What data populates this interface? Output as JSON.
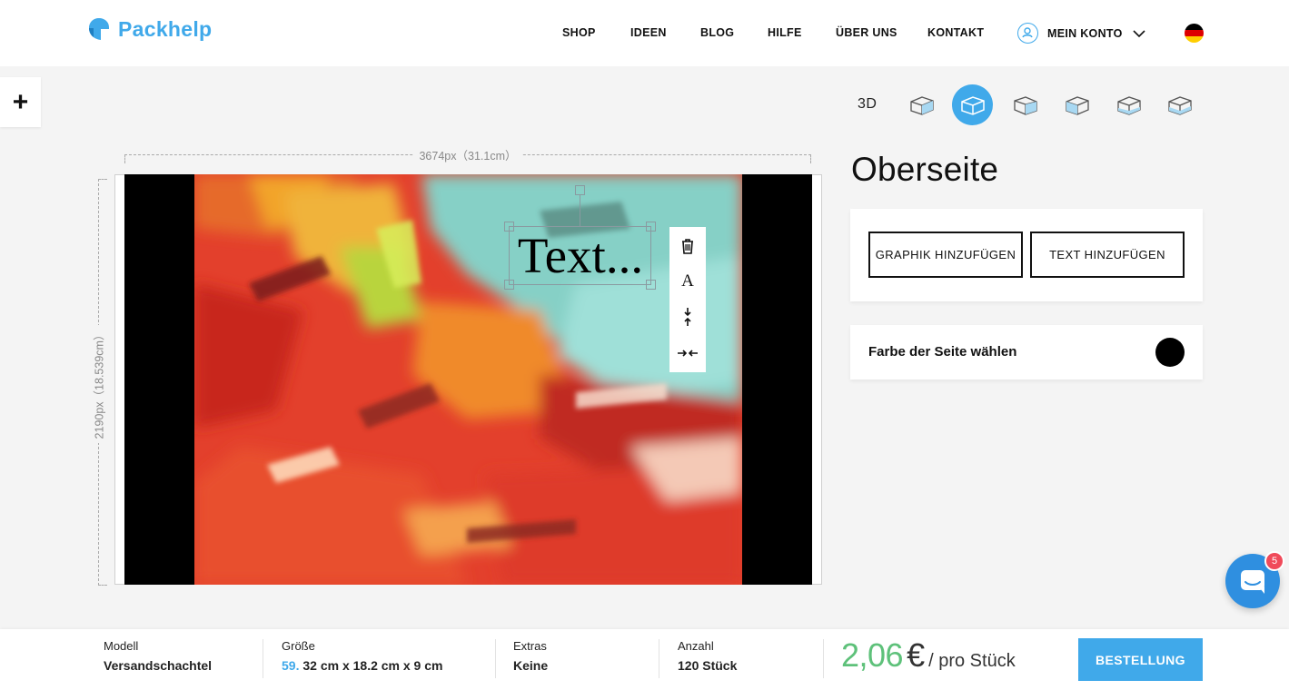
{
  "header": {
    "logo_text": "Packhelp",
    "nav": [
      "SHOP",
      "IDEEN",
      "BLOG",
      "HILFE",
      "ÜBER UNS",
      "KONTAKT"
    ],
    "account_label": "MEIN KONTO",
    "language_flag": "de-flag-icon"
  },
  "left_tools": {
    "add_icon": "+"
  },
  "views": {
    "three_d_label": "3D",
    "icons": [
      "box-view-1-icon",
      "box-view-top-icon",
      "box-view-3-icon",
      "box-view-4-icon",
      "box-view-5-icon",
      "box-view-6-icon"
    ],
    "active_index": 1
  },
  "editor": {
    "width_label": "3674px（31.1cm）",
    "height_label": "2190px（18.539cm）",
    "text_element": "Text...",
    "tools": {
      "delete_icon": "trash-icon",
      "font_glyph": "A",
      "line_height_icon": "line-height-icon",
      "letter_spacing_icon": "letter-spacing-icon"
    }
  },
  "side_panel": {
    "title": "Oberseite",
    "add_graphic": "GRAPHIK HINZUFÜGEN",
    "add_text": "TEXT HINZUFÜGEN",
    "color_label": "Farbe der Seite wählen",
    "side_color": "#000000"
  },
  "chat": {
    "badge_count": "5"
  },
  "footer": {
    "model_label": "Modell",
    "model_value": "Versandschachtel",
    "size_label": "Größe",
    "size_code": "59.",
    "size_value": "32 cm x 18.2 cm x 9 cm",
    "extras_label": "Extras",
    "extras_value": "Keine",
    "quantity_label": "Anzahl",
    "quantity_value": "120 Stück",
    "price_value": "2,06",
    "price_currency": "€",
    "price_unit": "/ pro Stück",
    "order_button": "BESTELLUNG"
  },
  "colors": {
    "accent": "#40a9ea",
    "price_green": "#5ec17a",
    "badge_red": "#f04a5a"
  }
}
